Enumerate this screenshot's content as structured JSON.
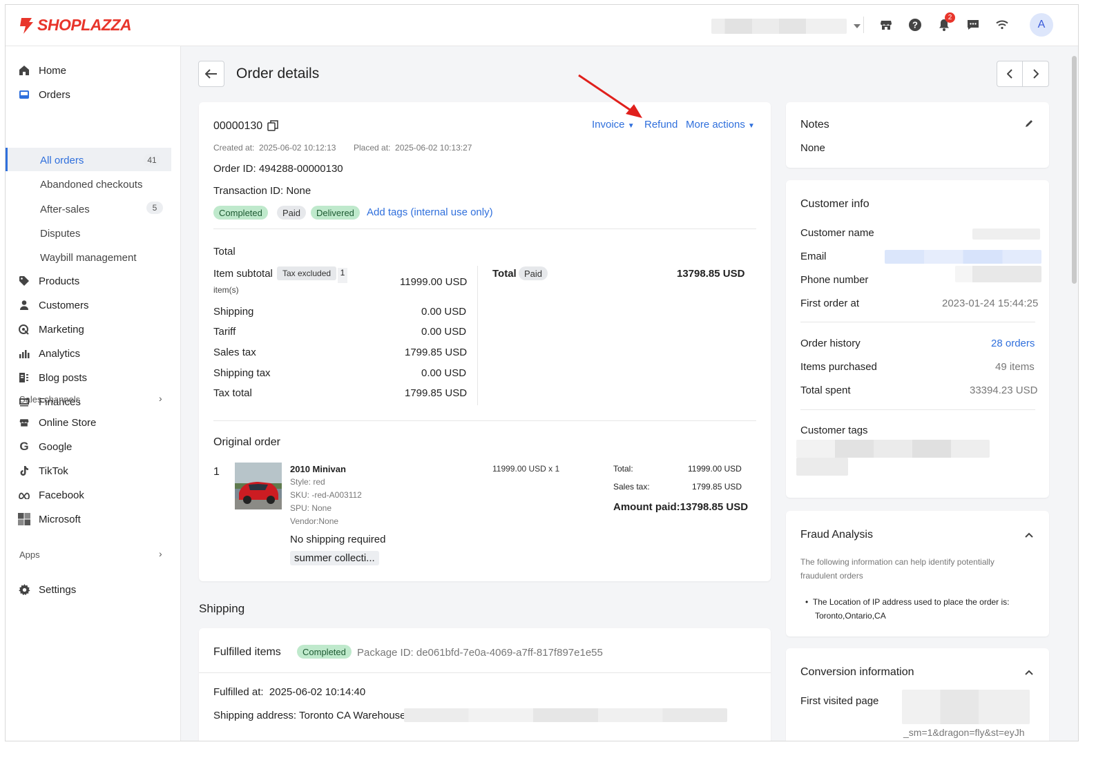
{
  "brand": {
    "name": "SHOPLAZZA",
    "color": "#e8352b"
  },
  "topbar": {
    "notification_count": "2",
    "avatar_letter": "A",
    "icons": [
      "store-icon",
      "help-icon",
      "bell-icon",
      "chat-icon",
      "wifi-icon"
    ]
  },
  "sidebar": {
    "home": "Home",
    "orders": "Orders",
    "all_orders": "All orders",
    "all_orders_count": "41",
    "abandoned": "Abandoned checkouts",
    "after_sales": "After-sales",
    "after_sales_count": "5",
    "disputes": "Disputes",
    "waybill": "Waybill management",
    "products": "Products",
    "customers": "Customers",
    "marketing": "Marketing",
    "analytics": "Analytics",
    "blog_posts": "Blog posts",
    "finances": "Finances",
    "sales_channels": "Sales channels",
    "online_store": "Online Store",
    "google": "Google",
    "tiktok": "TikTok",
    "facebook": "Facebook",
    "microsoft": "Microsoft",
    "apps": "Apps",
    "settings": "Settings"
  },
  "header": {
    "title": "Order details"
  },
  "order": {
    "number": "00000130",
    "invoice": "Invoice",
    "refund": "Refund",
    "more_actions": "More actions",
    "created_label": "Created at:",
    "created_value": "2025-06-02 10:12:13",
    "placed_label": "Placed at:",
    "placed_value": "2025-06-02 10:13:27",
    "order_id": "Order ID: 494288-00000130",
    "transaction_id": "Transaction ID: None",
    "tags": {
      "completed": "Completed",
      "paid": "Paid",
      "delivered": "Delivered"
    },
    "add_tags": "Add tags (internal use only)"
  },
  "totals": {
    "heading": "Total",
    "item_subtotal_label": "Item subtotal",
    "tax_excluded": "Tax excluded",
    "item_count": "1",
    "items_suffix": "item(s)",
    "item_subtotal_value": "11999.00 USD",
    "shipping_label": "Shipping",
    "shipping_value": "0.00 USD",
    "tariff_label": "Tariff",
    "tariff_value": "0.00 USD",
    "sales_tax_label": "Sales tax",
    "sales_tax_value": "1799.85 USD",
    "shipping_tax_label": "Shipping tax",
    "shipping_tax_value": "0.00 USD",
    "tax_total_label": "Tax total",
    "tax_total_value": "1799.85 USD",
    "total_label": "Total",
    "total_status": "Paid",
    "total_value": "13798.85 USD"
  },
  "original_order": {
    "heading": "Original order",
    "index": "1",
    "product_name": "2010 Minivan",
    "style": "Style: red",
    "sku": "SKU: -red-A003112",
    "spu": "SPU: None",
    "vendor": "Vendor:None",
    "unit_price": "11999.00 USD x 1",
    "total_label": "Total:",
    "total_value": "11999.00 USD",
    "sales_tax_label": "Sales tax:",
    "sales_tax_value": "1799.85 USD",
    "amount_paid": "Amount paid:13798.85 USD",
    "shipping_note": "No shipping required",
    "collection_tag": "summer collecti..."
  },
  "shipping": {
    "heading": "Shipping",
    "fulfilled_items": "Fulfilled items",
    "status": "Completed",
    "package_id": "Package ID: de061bfd-7e0a-4069-a7ff-817f897e1e55",
    "fulfilled_at_label": "Fulfilled at:",
    "fulfilled_at_value": "2025-06-02 10:14:40",
    "shipping_address": "Shipping address: Toronto CA Warehouse"
  },
  "notes": {
    "heading": "Notes",
    "value": "None"
  },
  "customer_info": {
    "heading": "Customer info",
    "name_label": "Customer name",
    "email_label": "Email",
    "phone_label": "Phone number",
    "first_order_label": "First order at",
    "first_order_value": "2023-01-24 15:44:25",
    "order_history_label": "Order history",
    "order_history_value": "28 orders",
    "items_purchased_label": "Items purchased",
    "items_purchased_value": "49 items",
    "total_spent_label": "Total spent",
    "total_spent_value": "33394.23 USD",
    "customer_tags_label": "Customer tags"
  },
  "fraud": {
    "heading": "Fraud Analysis",
    "description": "The following information can help identify potentially fraudulent orders",
    "item_line1": "The Location of IP address used to place the order is:",
    "item_line2": "Toronto,Ontario,CA"
  },
  "conversion": {
    "heading": "Conversion information",
    "first_visited_label": "First visited page",
    "first_visited_value": "_sm=1&dragon=fly&st=eyJh"
  },
  "colors": {
    "accent": "#2f6fdc",
    "success_bg": "#bfe9cc",
    "annotation_arrow": "#e0201c"
  }
}
